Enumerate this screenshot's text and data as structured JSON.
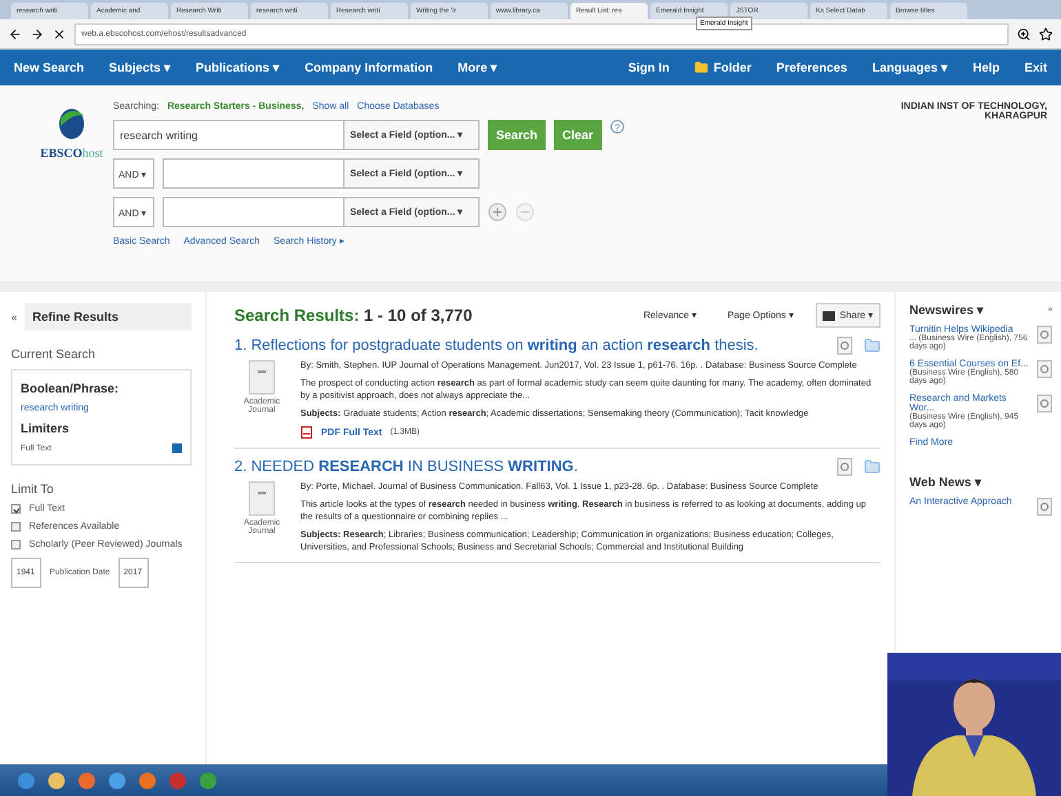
{
  "browser": {
    "tabs": [
      {
        "label": "research writi",
        "selected": false
      },
      {
        "label": "Academic and",
        "selected": false
      },
      {
        "label": "Research Writi",
        "selected": false
      },
      {
        "label": "research writi",
        "selected": false
      },
      {
        "label": "Research writi",
        "selected": false
      },
      {
        "label": "Writing the 'Ir",
        "selected": false
      },
      {
        "label": "www.library.ca",
        "selected": false
      },
      {
        "label": "Result List: res",
        "selected": true
      },
      {
        "label": "Emerald Insight",
        "selected": false
      },
      {
        "label": "JSTOR",
        "selected": false
      },
      {
        "label": "Ks Select Datab",
        "selected": false
      },
      {
        "label": "Browse titles",
        "selected": false
      }
    ],
    "tooltip": "Emerald Insight",
    "url": "web.a.ebscohost.com/ehost/resultsadvanced"
  },
  "nav": {
    "left": [
      "New Search",
      "Subjects ▾",
      "Publications ▾",
      "Company Information",
      "More ▾"
    ],
    "right": [
      "Sign In",
      "Folder",
      "Preferences",
      "Languages ▾",
      "Help",
      "Exit"
    ]
  },
  "search": {
    "searching": "Searching:",
    "database": "Research Starters - Business,",
    "show_all": "Show all",
    "choose": "Choose Databases",
    "rows": [
      {
        "operator": "",
        "value": "research writing",
        "field": "Select a Field (option... ▾"
      },
      {
        "operator": "AND ▾",
        "value": "",
        "field": "Select a Field (option... ▾"
      },
      {
        "operator": "AND ▾",
        "value": "",
        "field": "Select a Field (option... ▾"
      }
    ],
    "buttons": [
      "Search",
      "Clear"
    ],
    "help": "?",
    "links": [
      "Basic Search",
      "Advanced Search",
      "Search History ▸"
    ]
  },
  "logo": {
    "brand": "EBSCO",
    "suffix": "host"
  },
  "institution": "INDIAN INST OF TECHNOLOGY, KHARAGPUR",
  "refine": {
    "collapse": "«",
    "title": "Refine Results",
    "current_search": "Current Search",
    "boolean_label": "Boolean/Phrase:",
    "boolean_value": "research writing",
    "limiters_label": "Limiters",
    "limiter": "Full Text",
    "limit_to": "Limit To",
    "checkboxes": [
      {
        "label": "Full Text",
        "checked": true
      },
      {
        "label": "References Available",
        "checked": false
      },
      {
        "label": "Scholarly (Peer Reviewed) Journals",
        "checked": false
      }
    ],
    "date_from": "1941",
    "date_label": "Publication Date",
    "date_to": "2017"
  },
  "results": {
    "heading": "Search Results:",
    "range": "1 - 10 of 3,770",
    "options": [
      "Relevance ▾",
      "Page Options ▾",
      "Share ▾"
    ],
    "items": [
      {
        "number": "1.",
        "title": "Reflections for postgraduate students on **writing** an action **research** thesis.",
        "meta": "By: Smith, Stephen. IUP Journal of Operations Management. Jun2017, Vol. 23 Issue 1, p61-76. 16p. . Database: Business Source Complete",
        "abstract": "The prospect of conducting action **research** as part of formal academic study can seem quite daunting for many. The academy, often dominated by a positivist approach, does not always appreciate the...",
        "subjects": "**Subjects:** Graduate students; Action **research**; Academic dissertations; Sensemaking theory (Communication); Tacit knowledge",
        "type": "Academic Journal",
        "pdf": "PDF Full Text",
        "pdf_size": "(1.3MB)"
      },
      {
        "number": "2.",
        "title": "NEEDED **RESEARCH** IN BUSINESS **WRITING**.",
        "meta": "By: Porte, Michael. Journal of Business Communication. Fall63, Vol. 1 Issue 1, p23-28. 6p. . Database: Business Source Complete",
        "abstract": "This article looks at the types of **research** needed in business **writing**. **Research** in business is referred to as looking at documents, adding up the results of a questionnaire or combining replies ...",
        "subjects": "**Subjects: Research**; Libraries; Business communication; Leadership; Communication in organizations; Business education; Colleges, Universities, and Professional Schools; Business and Secretarial Schools; Commercial and Institutional Building",
        "type": "Academic Journal"
      }
    ]
  },
  "side": {
    "expand": "»",
    "newswires": "Newswires ▾",
    "news": [
      {
        "title": "Turnitin Helps Wikipedia",
        "source": "... (Business Wire (English), 756 days ago)"
      },
      {
        "title": "6 Essential Courses on Ef...",
        "source": "(Business Wire (English), 580 days ago)"
      },
      {
        "title": "Research and Markets Wor...",
        "source": "(Business Wire (English), 945 days ago)"
      }
    ],
    "find_more": "Find More",
    "web_news": "Web News ▾",
    "web": [
      {
        "title": "An Interactive Approach"
      }
    ]
  }
}
